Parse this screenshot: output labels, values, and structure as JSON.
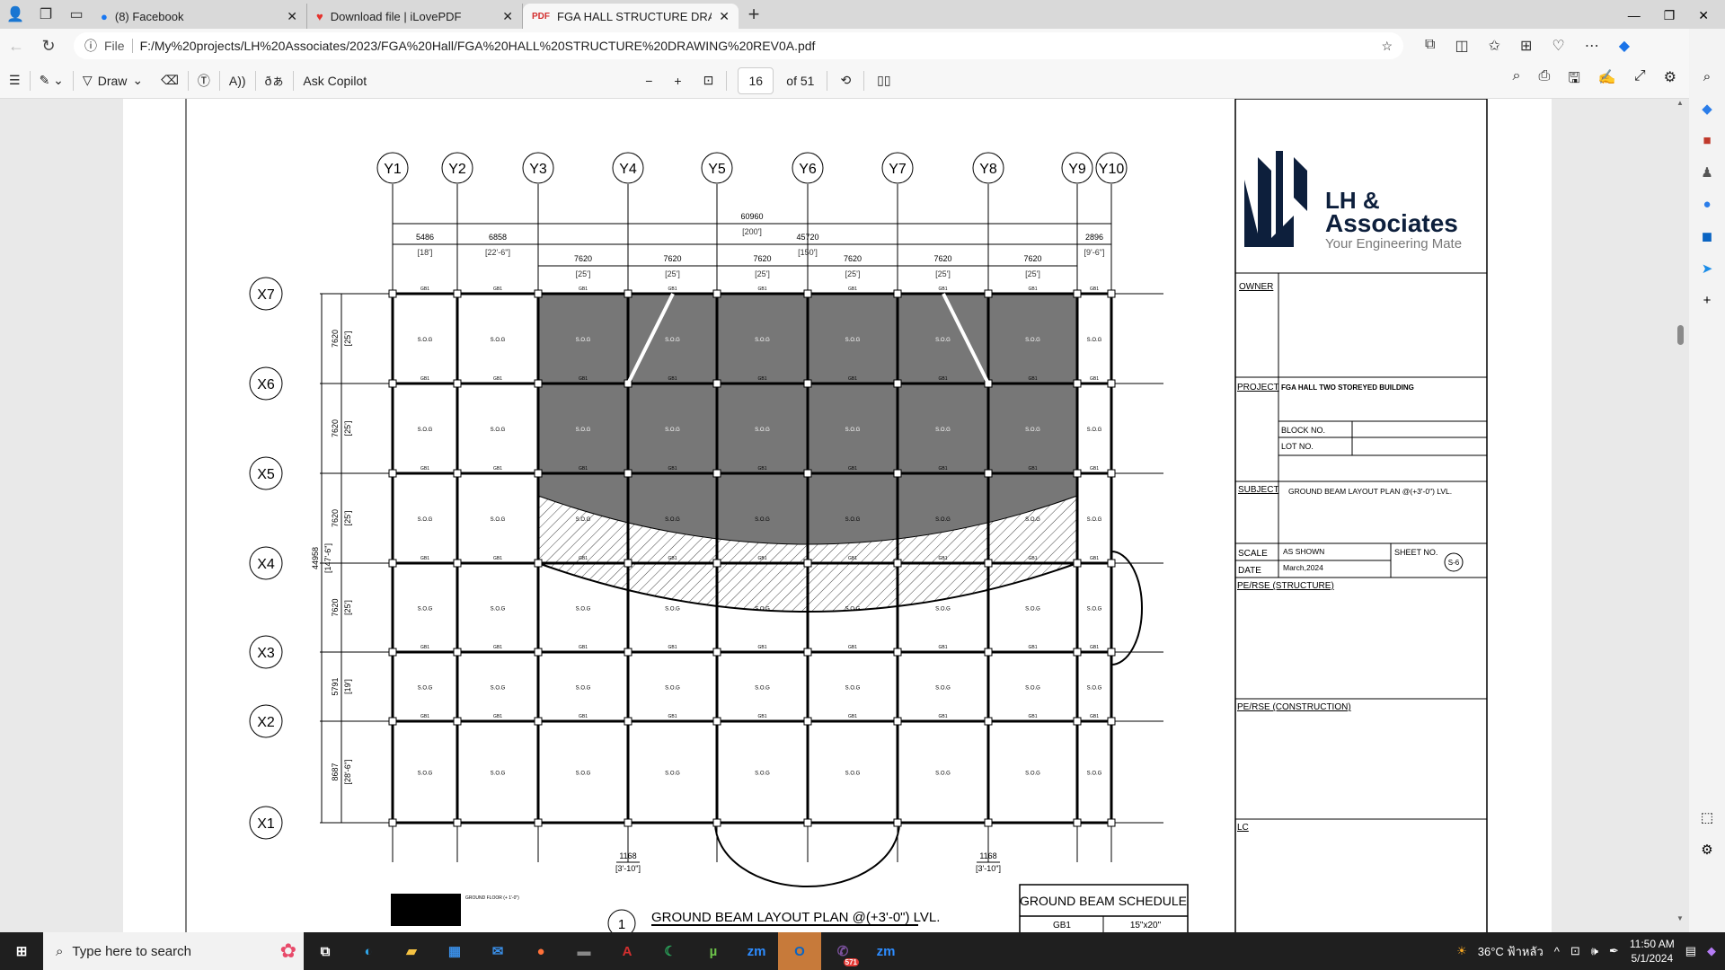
{
  "browser": {
    "tabs": [
      {
        "label": "(8) Facebook",
        "icon": "facebook-icon",
        "color": "#1877f2"
      },
      {
        "label": "Download file | iLovePDF",
        "icon": "ilovepdf-icon",
        "color": "#e5322d"
      },
      {
        "label": "FGA HALL STRUCTURE DRAWING",
        "icon": "pdf-icon",
        "color": "#d32f2f"
      }
    ],
    "new_tab": "+",
    "url_prefix": "File",
    "url": "F:/My%20projects/LH%20Associates/2023/FGA%20Hall/FGA%20HALL%20STRUCTURE%20DRAWING%20REV0A.pdf"
  },
  "pdf_toolbar": {
    "draw": "Draw",
    "ask_copilot": "Ask Copilot",
    "page": "16",
    "of_pages": "of 51"
  },
  "title_block": {
    "company_line1": "LH &",
    "company_line2": "Associates",
    "tagline": "Your Engineering Mate",
    "owner_label": "OWNER",
    "project_label": "PROJECT",
    "project": "FGA HALL TWO STOREYED BUILDING",
    "block_label": "BLOCK NO.",
    "lot_label": "LOT NO.",
    "subject_label": "SUBJECT",
    "subject": "GROUND BEAM LAYOUT PLAN @(+3'-0\") LVL.",
    "scale_label": "SCALE",
    "scale": "AS SHOWN",
    "date_label": "DATE",
    "date": "March,2024",
    "sheet_label": "SHEET NO.",
    "sheet": "S-6",
    "pe_structure": "PE/RSE (STRUCTURE)",
    "pe_construction": "PE/RSE (CONSTRUCTION)",
    "lc": "LC",
    "brand_color": "#0d1f3c"
  },
  "drawing": {
    "grid_y": [
      "Y1",
      "Y2",
      "Y3",
      "Y4",
      "Y5",
      "Y6",
      "Y7",
      "Y8",
      "Y9",
      "Y10"
    ],
    "grid_x": [
      "X7",
      "X6",
      "X5",
      "X4",
      "X3",
      "X2",
      "X1"
    ],
    "dim_total": "60960",
    "dim_total_ft": "[200']",
    "dim_top": [
      {
        "v": "5486",
        "f": "[18']"
      },
      {
        "v": "6858",
        "f": "[22'-6\"]"
      },
      {
        "v": "45720",
        "f": "[150']"
      },
      {
        "v": "2896",
        "f": "[9'-6\"]"
      }
    ],
    "dim_bays": [
      {
        "v": "7620",
        "f": "[25']"
      },
      {
        "v": "7620",
        "f": "[25']"
      },
      {
        "v": "7620",
        "f": "[25']"
      },
      {
        "v": "7620",
        "f": "[25']"
      },
      {
        "v": "7620",
        "f": "[25']"
      },
      {
        "v": "7620",
        "f": "[25']"
      }
    ],
    "dim_left": [
      {
        "v": "7620",
        "f": "[25']"
      },
      {
        "v": "7620",
        "f": "[25']"
      },
      {
        "v": "7620",
        "f": "[25']"
      },
      {
        "v": "7620",
        "f": "[25']"
      },
      {
        "v": "5791",
        "f": "[19']"
      },
      {
        "v": "8687",
        "f": "[28'-6\"]"
      }
    ],
    "dim_left_total": "44958",
    "dim_left_total_ft": "[147'-6\"]",
    "dim_bottom": [
      {
        "v": "1168",
        "f": "[3'-10\"]"
      },
      {
        "v": "1168",
        "f": "[3'-10\"]"
      }
    ],
    "beam_label": "GB1",
    "slab_label": "S.O.G",
    "legend_text": "GROUND FLOOR (+ 1'-0\")",
    "plan_number": "1",
    "plan_title": "GROUND BEAM LAYOUT PLAN @(+3'-0\") LVL.",
    "schedule_title": "GROUND BEAM SCHEDULE",
    "schedule_rows": [
      [
        "GB1",
        "15\"x20\""
      ]
    ]
  },
  "taskbar": {
    "search_placeholder": "Type here to search",
    "apps": [
      "edge-icon",
      "file-explorer-icon",
      "store-icon",
      "mail-icon",
      "firefox-icon",
      "terminal-icon",
      "autocad-icon",
      "app-icon",
      "utorrent-icon",
      "zoom-icon",
      "outlook-icon",
      "viber-icon",
      "zoom-icon"
    ],
    "viber_badge": "571",
    "weather": "36°C ฟ้าหลัว",
    "time": "11:50 AM",
    "date": "5/1/2024"
  }
}
